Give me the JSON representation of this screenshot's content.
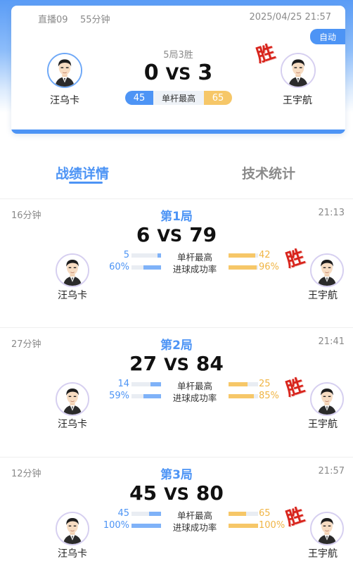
{
  "header": {
    "source": "直播09",
    "duration": "55分钟",
    "datetime": "2025/04/25 21:57",
    "auto_label": "自动",
    "format": "5局3胜",
    "left_player": "汪乌卡",
    "right_player": "王宇航",
    "left_score": "0",
    "right_score": "3",
    "vs": "VS",
    "left_high_break": "45",
    "right_high_break": "65",
    "high_break_label": "单杆最高",
    "winner_mark": "胜"
  },
  "tabs": {
    "details": "战绩详情",
    "stats": "技术统计"
  },
  "games": [
    {
      "title": "第1局",
      "duration": "16分钟",
      "time": "21:13",
      "left_score": "6",
      "right_score": "79",
      "vs": "VS",
      "left_player": "汪乌卡",
      "right_player": "王宇航",
      "winner_mark": "胜",
      "high_break_label": "单杆最高",
      "left_high_break": "5",
      "right_high_break": "42",
      "left_high_break_fill": 0.12,
      "right_high_break_fill": 0.9,
      "pot_rate_label": "进球成功率",
      "left_pot_rate": "60%",
      "right_pot_rate": "96%",
      "left_pot_rate_fill": 0.6,
      "right_pot_rate_fill": 0.96
    },
    {
      "title": "第2局",
      "duration": "27分钟",
      "time": "21:41",
      "left_score": "27",
      "right_score": "84",
      "vs": "VS",
      "left_player": "汪乌卡",
      "right_player": "王宇航",
      "winner_mark": "胜",
      "high_break_label": "单杆最高",
      "left_high_break": "14",
      "right_high_break": "25",
      "left_high_break_fill": 0.36,
      "right_high_break_fill": 0.64,
      "pot_rate_label": "进球成功率",
      "left_pot_rate": "59%",
      "right_pot_rate": "85%",
      "left_pot_rate_fill": 0.59,
      "right_pot_rate_fill": 0.85
    },
    {
      "title": "第3局",
      "duration": "12分钟",
      "time": "21:57",
      "left_score": "45",
      "right_score": "80",
      "vs": "VS",
      "left_player": "汪乌卡",
      "right_player": "王宇航",
      "winner_mark": "胜",
      "high_break_label": "单杆最高",
      "left_high_break": "45",
      "right_high_break": "65",
      "left_high_break_fill": 0.41,
      "right_high_break_fill": 0.59,
      "pot_rate_label": "进球成功率",
      "left_pot_rate": "100%",
      "right_pot_rate": "100%",
      "left_pot_rate_fill": 1.0,
      "right_pot_rate_fill": 1.0
    }
  ],
  "colors": {
    "accent": "#4d94f5",
    "opponent": "#f6c768",
    "winner": "#d8231b"
  }
}
